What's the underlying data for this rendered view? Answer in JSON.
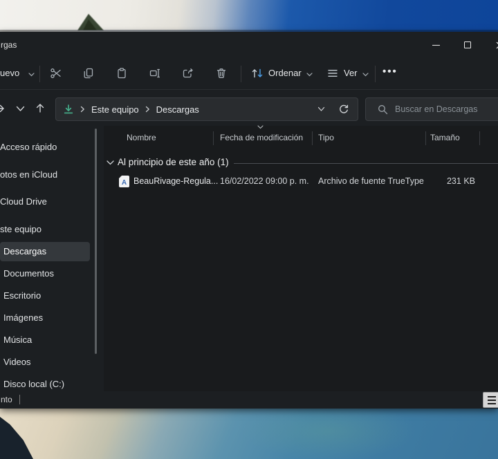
{
  "window": {
    "title": "rgas"
  },
  "toolbar": {
    "new_label": "uevo",
    "sort_label": "Ordenar",
    "view_label": "Ver",
    "more_label": "•••"
  },
  "navigation": {
    "breadcrumb_root": "Este equipo",
    "breadcrumb_current": "Descargas",
    "search_placeholder": "Buscar en Descargas"
  },
  "sidebar": {
    "items": [
      {
        "label": "Acceso rápido",
        "selected": false
      },
      {
        "label": "otos en iCloud",
        "selected": false
      },
      {
        "label": "Cloud Drive",
        "selected": false
      },
      {
        "label": "ste equipo",
        "selected": false
      },
      {
        "label": "Descargas",
        "selected": true
      },
      {
        "label": "Documentos",
        "selected": false
      },
      {
        "label": "Escritorio",
        "selected": false
      },
      {
        "label": "Imágenes",
        "selected": false
      },
      {
        "label": "Música",
        "selected": false
      },
      {
        "label": "Videos",
        "selected": false
      },
      {
        "label": "Disco local (C:)",
        "selected": false
      }
    ]
  },
  "file_list": {
    "columns": [
      {
        "label": "Nombre"
      },
      {
        "label": "Fecha de modificación",
        "sorted": true
      },
      {
        "label": "Tipo"
      },
      {
        "label": "Tamaño"
      }
    ],
    "group_header": "Al principio de este año (1)",
    "rows": [
      {
        "name": "BeauRivage-Regula...",
        "modified": "16/02/2022 09:00 p. m.",
        "type": "Archivo de fuente TrueType",
        "size": "231 KB",
        "icon": "truetype-font-file-icon",
        "icon_letter": "A"
      }
    ]
  },
  "status_bar": {
    "items_text": "nto"
  },
  "colors": {
    "accent_sort_arrow": "#4da0e8",
    "downloads_icon_green": "#46b28e",
    "chrome_bg": "#1c1f22",
    "content_bg": "#191b1d",
    "selection_bg": "#34383c",
    "wallpaper_sky_blue": "#11489c",
    "wallpaper_water_blue": "#4785a8"
  }
}
